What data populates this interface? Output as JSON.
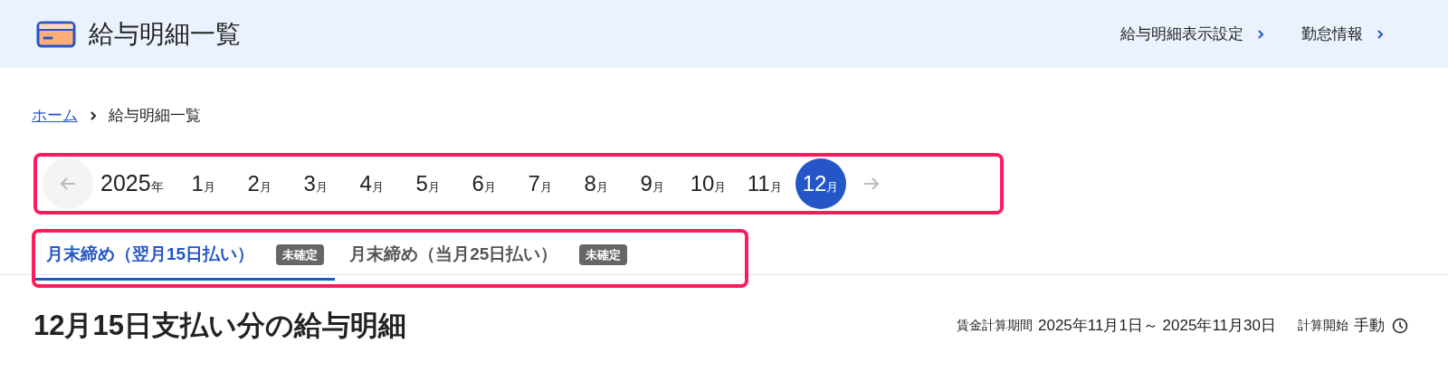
{
  "header": {
    "title": "給与明細一覧",
    "links": [
      {
        "label": "給与明細表示設定"
      },
      {
        "label": "勤怠情報"
      }
    ]
  },
  "breadcrumb": {
    "home": "ホーム",
    "current": "給与明細一覧"
  },
  "month_picker": {
    "year": "2025",
    "year_unit": "年",
    "months": [
      {
        "number": "1",
        "unit": "月",
        "selected": false
      },
      {
        "number": "2",
        "unit": "月",
        "selected": false
      },
      {
        "number": "3",
        "unit": "月",
        "selected": false
      },
      {
        "number": "4",
        "unit": "月",
        "selected": false
      },
      {
        "number": "5",
        "unit": "月",
        "selected": false
      },
      {
        "number": "6",
        "unit": "月",
        "selected": false
      },
      {
        "number": "7",
        "unit": "月",
        "selected": false
      },
      {
        "number": "8",
        "unit": "月",
        "selected": false
      },
      {
        "number": "9",
        "unit": "月",
        "selected": false
      },
      {
        "number": "10",
        "unit": "月",
        "selected": false
      },
      {
        "number": "11",
        "unit": "月",
        "selected": false
      },
      {
        "number": "12",
        "unit": "月",
        "selected": true
      }
    ]
  },
  "tabs": [
    {
      "label": "月末締め（翌月15日払い）",
      "badge": "未確定",
      "selected": true
    },
    {
      "label": "月末締め（当月25日払い）",
      "badge": "未確定",
      "selected": false
    }
  ],
  "payslip": {
    "title": "12月15日支払い分の給与明細",
    "period_label": "賃金計算期間",
    "period": "2025年11月1日～ 2025年11月30日",
    "calc_label": "計算開始",
    "calc_value": "手動"
  }
}
